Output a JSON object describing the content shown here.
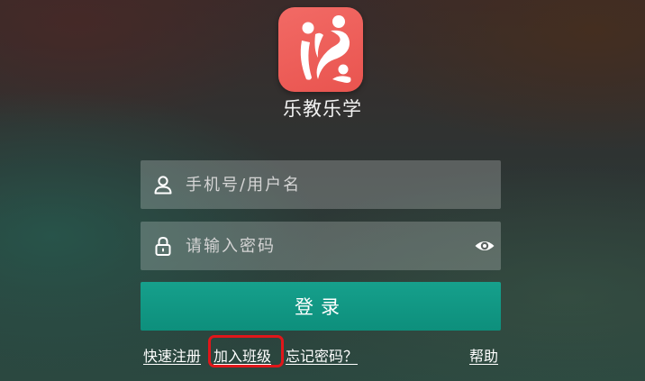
{
  "app": {
    "name": "乐教乐学",
    "logo_icon": "people-logo-icon",
    "logo_color": "#ee5e59"
  },
  "form": {
    "username": {
      "placeholder": "手机号/用户名",
      "value": "",
      "icon": "user-icon"
    },
    "password": {
      "placeholder": "请输入密码",
      "value": "",
      "icon": "lock-icon",
      "toggle_icon": "eye-icon"
    },
    "login_label": "登录",
    "login_color": "#109582"
  },
  "links": {
    "register": "快速注册",
    "join_class": "加入班级",
    "forgot_password": "忘记密码？",
    "help": "帮助"
  },
  "annotation": {
    "highlight_color": "#e0161a"
  }
}
